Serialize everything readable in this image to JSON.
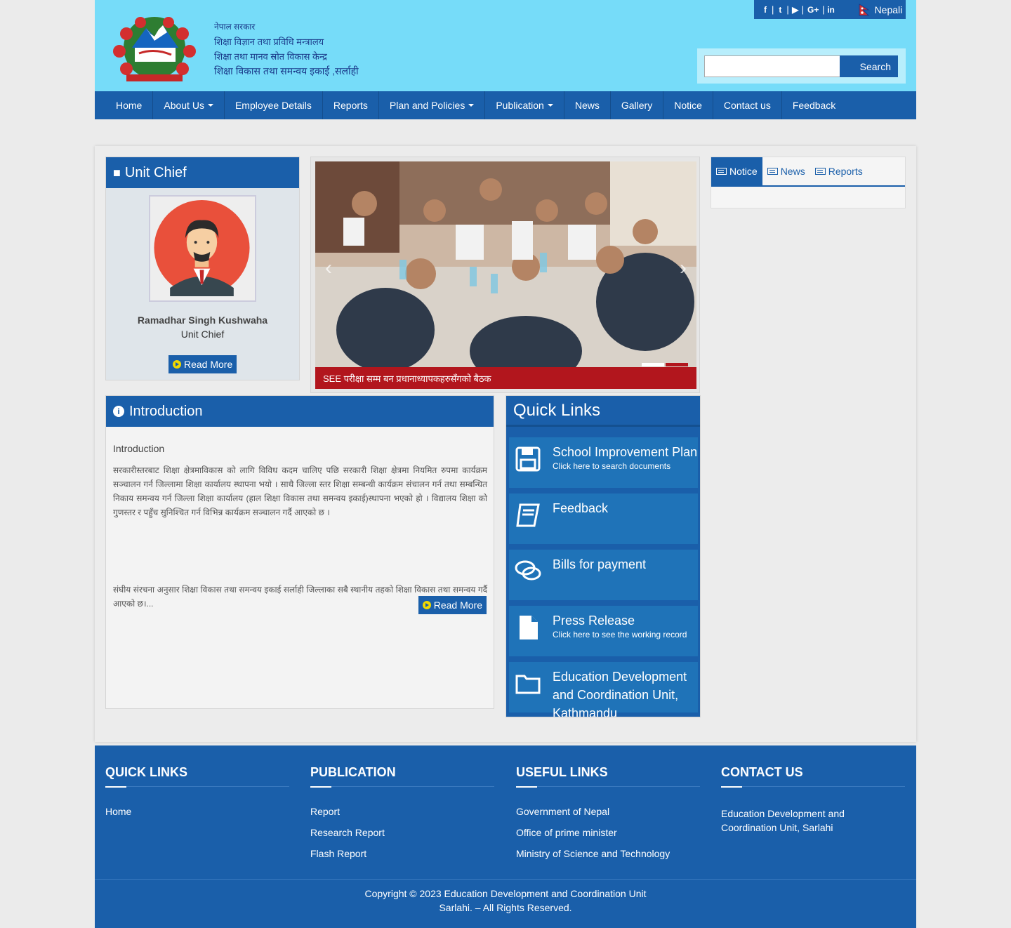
{
  "header": {
    "office_lines": [
      "नेपाल सरकार",
      "शिक्षा विज्ञान तथा प्रविधि मन्त्रालय",
      "शिक्षा तथा मानव स्रोत विकास केन्द्र",
      "शिक्षा विकास तथा समन्वय इकाई ,सर्लाही"
    ],
    "language": "Nepali",
    "search_button": "Search",
    "search_placeholder": "",
    "social_icons": [
      "facebook-icon",
      "twitter-icon",
      "youtube-icon",
      "google-plus-icon",
      "linkedin-icon"
    ]
  },
  "nav": [
    {
      "label": "Home",
      "dropdown": false
    },
    {
      "label": "About Us",
      "dropdown": true
    },
    {
      "label": "Employee Details",
      "dropdown": false
    },
    {
      "label": "Reports",
      "dropdown": false
    },
    {
      "label": "Plan and Policies",
      "dropdown": true
    },
    {
      "label": "Publication",
      "dropdown": true
    },
    {
      "label": "News",
      "dropdown": false
    },
    {
      "label": "Gallery",
      "dropdown": false
    },
    {
      "label": "Notice",
      "dropdown": false
    },
    {
      "label": "Contact us",
      "dropdown": false
    },
    {
      "label": "Feedback",
      "dropdown": false
    }
  ],
  "chief": {
    "heading": "Unit Chief",
    "name": "Ramadhar Singh Kushwaha",
    "title": "Unit Chief",
    "read_more": "Read More"
  },
  "slider": {
    "caption": "SEE परीक्षा सम्म बन प्रधानाध्यापकहरुसँगको बैठक"
  },
  "tabs": [
    "Notice",
    "News",
    "Reports"
  ],
  "intro": {
    "heading": "Introduction",
    "subheading": "Introduction",
    "body": "सरकारीस्तरबाट शिक्षा क्षेत्रमाविकास को लागि विविध कदम चालिए पछि सरकारी शिक्षा क्षेत्रमा नियमित रुपमा कार्यक्रम सञ्चालन गर्न जिल्लामा शिक्षा कार्यालय स्थापना भयो । साथै जिल्ला स्तर शिक्षा सम्बन्धी कार्यक्रम संचालन गर्न तथा सम्बन्धित निकाय समन्वय गर्न जिल्ला शिक्षा कार्यालय (हाल शिक्षा विकास तथा समन्वय इकाई)स्थापना भएको हो । विद्यालय शिक्षा को गुणस्तर र पहुँच सुनिश्चित गर्न विभिन्न कार्यक्रम सञ्चालन गर्दै आएको छ ।",
    "body2": "संघीय संरचना अनुसार शिक्षा विकास तथा समन्वय इकाई सर्लाही जिल्लाका सबै स्थानीय तहको शिक्षा विकास तथा समन्वय गर्दै आएको छ।...",
    "read_more": "Read More"
  },
  "quick_links": {
    "heading": "Quick Links",
    "items": [
      {
        "title": "School Improvement Plan",
        "subtitle": "Click here to search documents",
        "icon": "floppy-disk-icon"
      },
      {
        "title": "Feedback",
        "subtitle": "",
        "icon": "book-icon"
      },
      {
        "title": "Bills for payment",
        "subtitle": "",
        "icon": "comments-icon"
      },
      {
        "title": "Press Release",
        "subtitle": "Click here to see the working record",
        "icon": "file-icon"
      },
      {
        "title": "Education Development and Coordination Unit, Kathmandu",
        "subtitle": "",
        "icon": "folder-icon"
      }
    ]
  },
  "footer": {
    "quick_links": {
      "heading": "QUICK LINKS",
      "items": [
        "Home"
      ]
    },
    "publication": {
      "heading": "PUBLICATION",
      "items": [
        "Report",
        "Research Report",
        "Flash Report"
      ]
    },
    "useful_links": {
      "heading": "USEFUL LINKS",
      "items": [
        "Government of Nepal",
        "Office of prime minister",
        "Ministry of Science and Technology"
      ]
    },
    "contact": {
      "heading": "CONTACT US",
      "address": " Education Development and Coordination Unit, Sarlahi"
    },
    "copyright_line1": "Copyright © 2023 Education Development and Coordination Unit",
    "copyright_line2": "Sarlahi. – All Rights Reserved."
  },
  "colors": {
    "primary": "#1a5faa",
    "header_bg": "#76dcf9",
    "caption_bg": "#b2161d"
  }
}
